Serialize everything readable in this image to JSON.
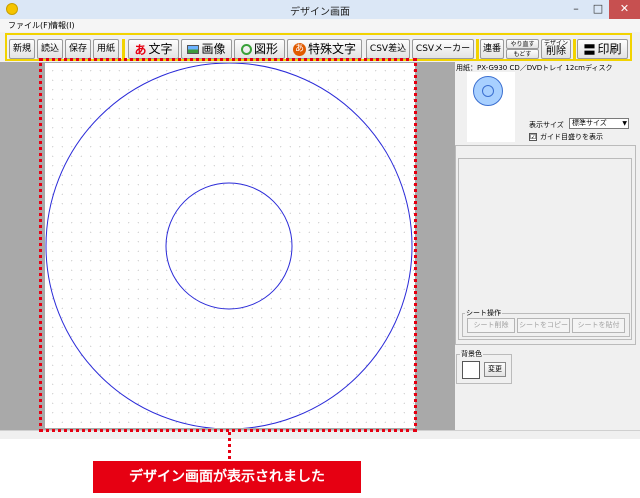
{
  "window": {
    "title": "デザイン画面",
    "min_symbol": "–",
    "max_symbol": "□",
    "close_symbol": "✕"
  },
  "menu": {
    "file": "ファイル(F)",
    "info": "情報(I)"
  },
  "toolbar": {
    "new": "新規",
    "load": "読込",
    "save": "保存",
    "paper": "用紙",
    "text_glyph": "あ",
    "text": "文字",
    "image": "画像",
    "shape": "図形",
    "special_glyph": "あ",
    "special_text": "特殊文字",
    "csv_merge": "CSV差込",
    "csv_maker": "CSVメーカー",
    "serial": "連番",
    "redo": "やり直す",
    "undo": "もどす",
    "delete_top": "デザイン",
    "delete": "削除",
    "print_glyph": "〓",
    "print": "印刷"
  },
  "panel": {
    "paper_label": "用紙：PX-G930 CD／DVDトレイ 12cmディスク",
    "display_size_label": "表示サイズ",
    "display_size_value": "標準サイズ",
    "guide_check": "☑",
    "guide_label": "ガイド目盛りを表示",
    "sheet_ops_title": "シート操作",
    "sheet_delete": "シート削除",
    "sheet_copy": "シートをコピー",
    "sheet_paste": "シートを貼付",
    "bg_title": "背景色",
    "bg_change": "変更"
  },
  "callout": {
    "text": "デザイン画面が表示されました"
  },
  "colors": {
    "accent_red": "#e60012",
    "toolbar_yellow": "#f2d300",
    "disc_blue": "#2b2bd8"
  }
}
